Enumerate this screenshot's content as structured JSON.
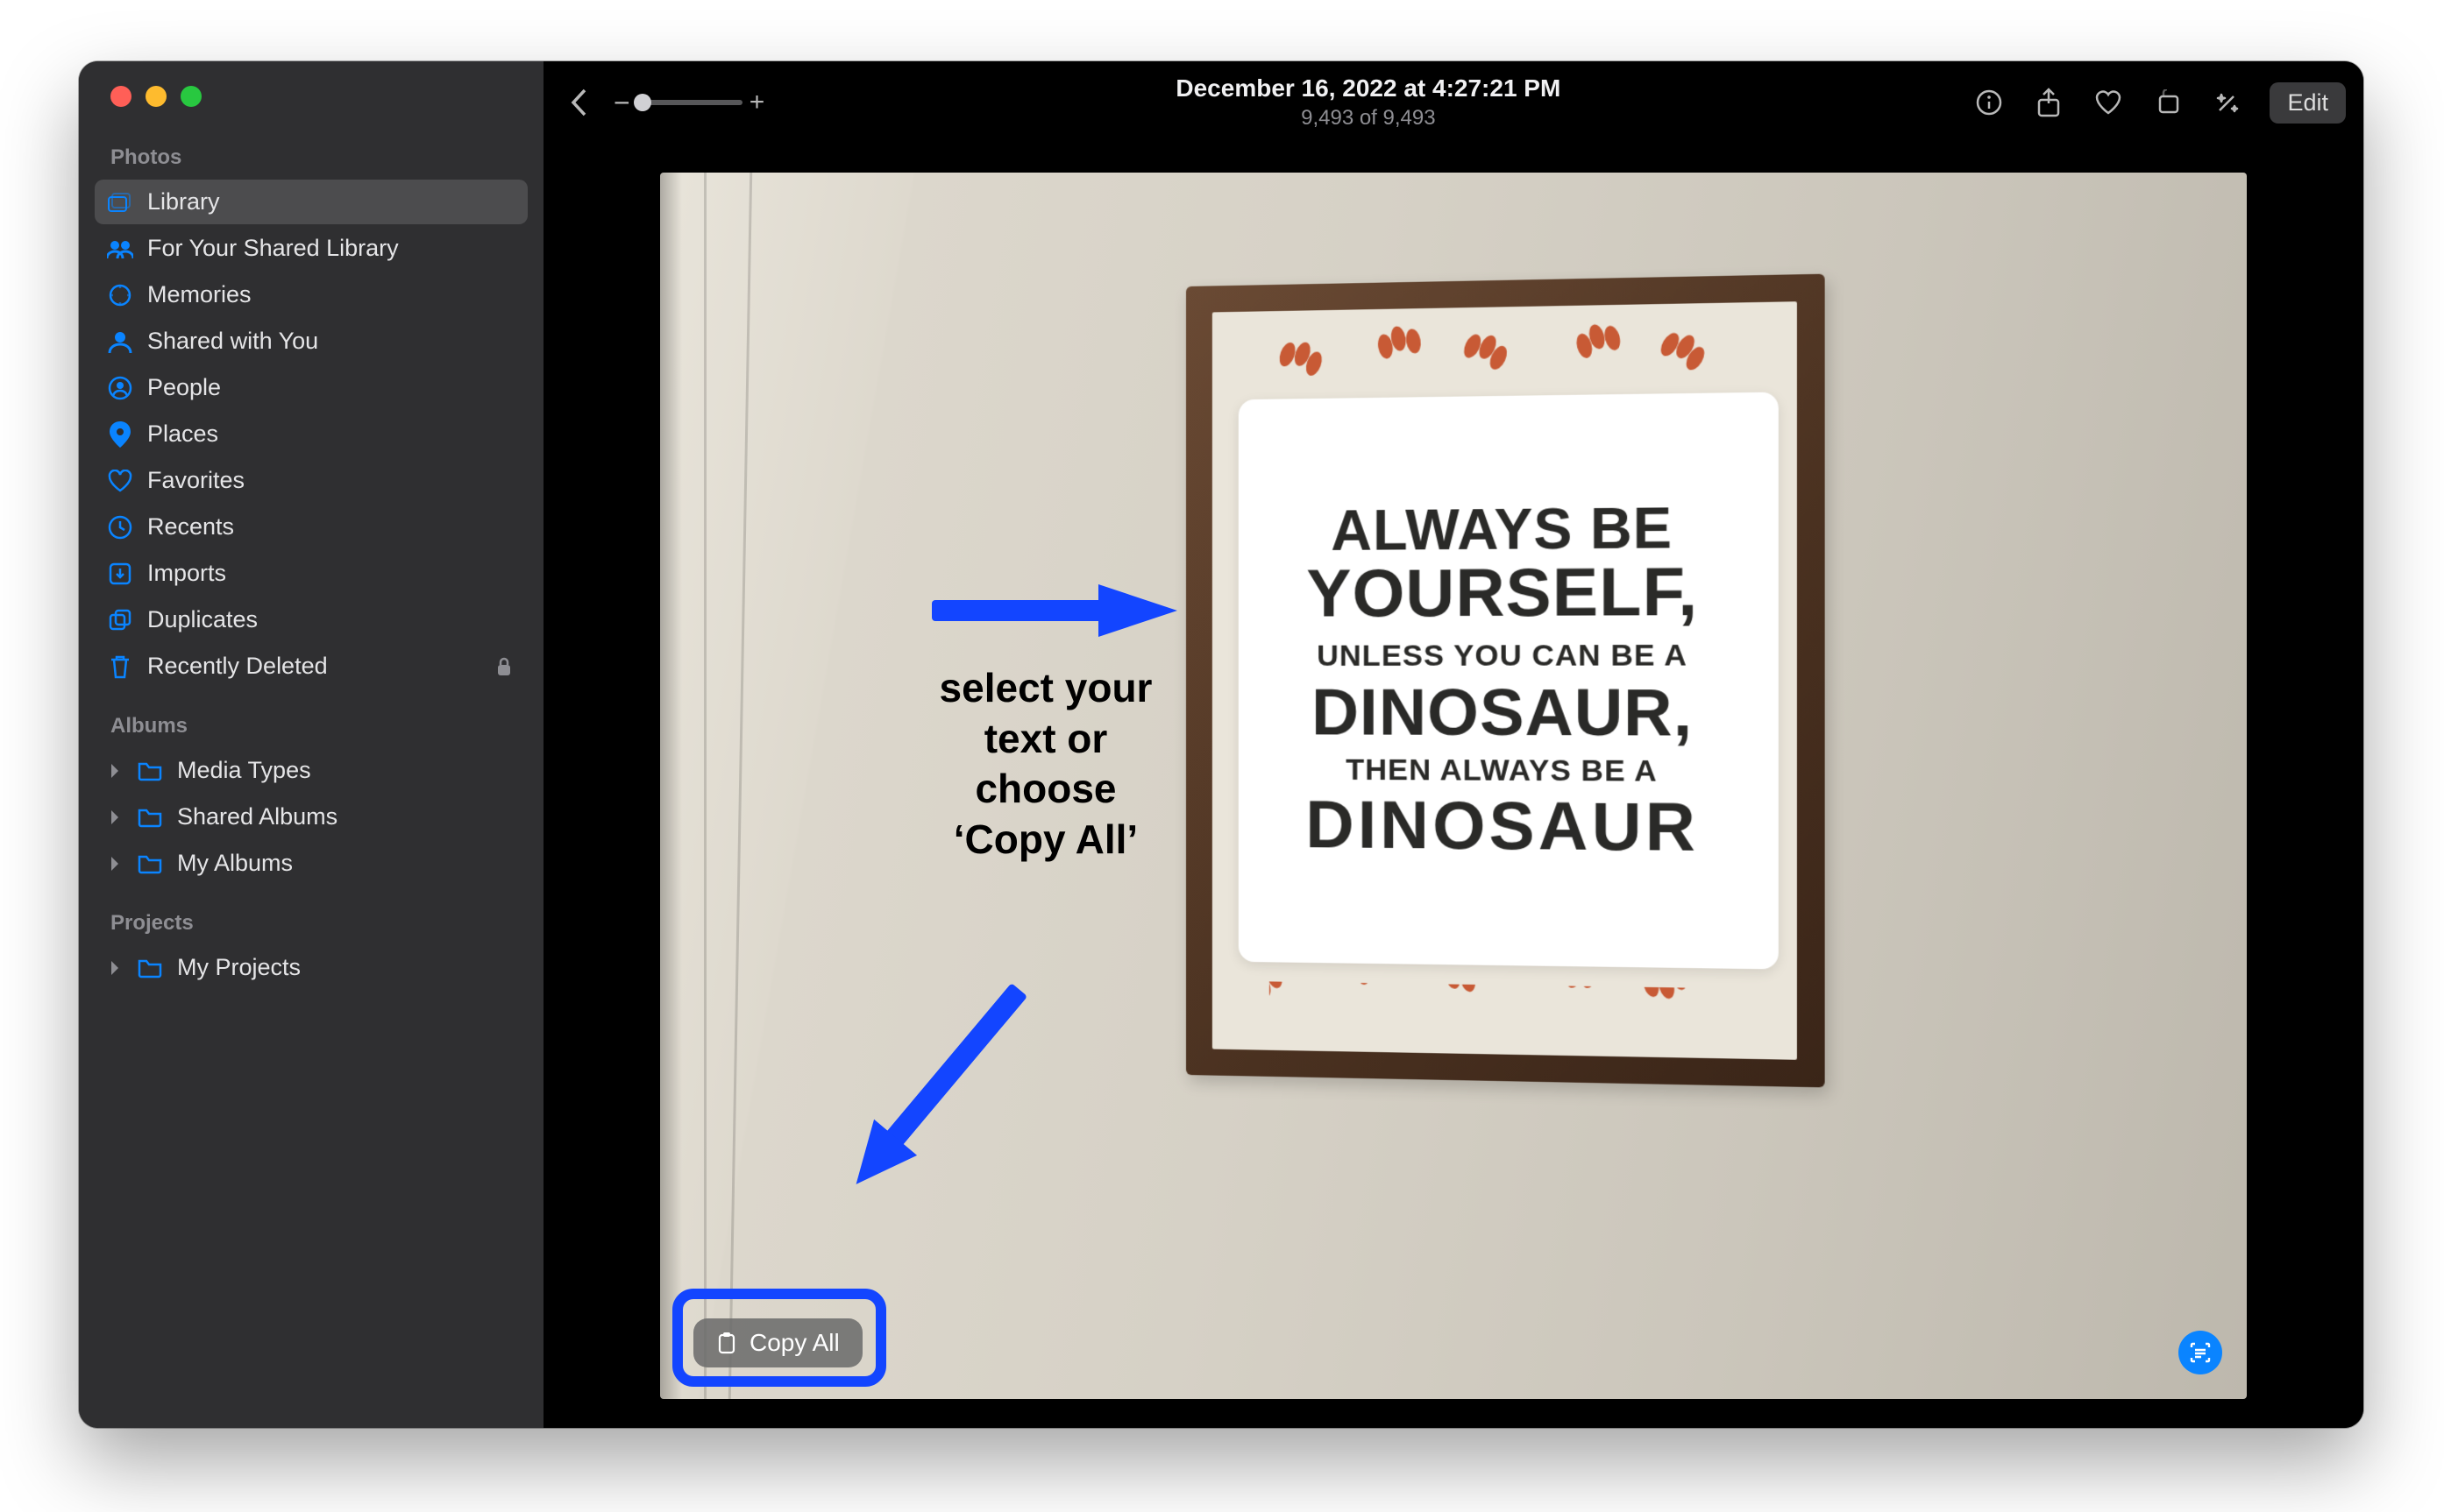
{
  "header": {
    "timestamp": "December 16, 2022 at 4:27:21 PM",
    "count": "9,493 of 9,493",
    "edit": "Edit"
  },
  "zoom": {
    "minus": "−",
    "plus": "+"
  },
  "sidebar": {
    "sectionPhotos": "Photos",
    "sectionAlbums": "Albums",
    "sectionProjects": "Projects",
    "items": {
      "library": "Library",
      "forYourSharedLibrary": "For Your Shared Library",
      "memories": "Memories",
      "sharedWithYou": "Shared with You",
      "people": "People",
      "places": "Places",
      "favorites": "Favorites",
      "recents": "Recents",
      "imports": "Imports",
      "duplicates": "Duplicates",
      "recentlyDeleted": "Recently Deleted",
      "mediaTypes": "Media Types",
      "sharedAlbums": "Shared Albums",
      "myAlbums": "My Albums",
      "myProjects": "My Projects"
    }
  },
  "artwork": {
    "l1": "ALWAYS BE",
    "l2": "YOURSELF,",
    "l3": "UNLESS YOU CAN BE A",
    "l4": "DINOSAUR,",
    "l5": "THEN ALWAYS BE A",
    "l6": "DINOSAUR"
  },
  "annotation": {
    "line1": "select your",
    "line2": "text or",
    "line3": "choose",
    "line4": "‘Copy All’"
  },
  "copyAll": "Copy All"
}
